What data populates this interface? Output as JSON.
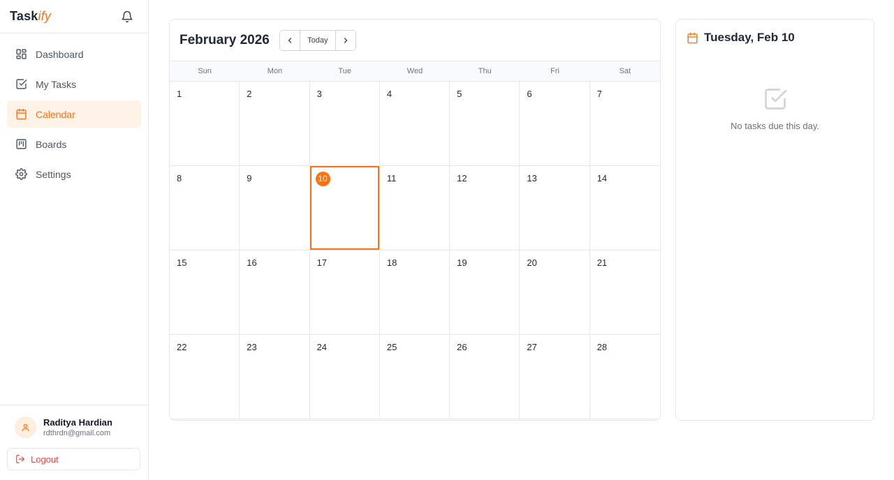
{
  "brand": {
    "name": "Task",
    "accent": "ify"
  },
  "nav": [
    {
      "label": "Dashboard",
      "icon": "dashboard-icon",
      "active": false
    },
    {
      "label": "My Tasks",
      "icon": "checkbox-icon",
      "active": false
    },
    {
      "label": "Calendar",
      "icon": "calendar-icon",
      "active": true
    },
    {
      "label": "Boards",
      "icon": "board-icon",
      "active": false
    },
    {
      "label": "Settings",
      "icon": "gear-icon",
      "active": false
    }
  ],
  "user": {
    "name": "Raditya Hardian",
    "email": "rdthrdn@gmail.com",
    "logout_label": "Logout"
  },
  "calendar": {
    "month_title": "February 2026",
    "today_label": "Today",
    "weekdays": [
      "Sun",
      "Mon",
      "Tue",
      "Wed",
      "Thu",
      "Fri",
      "Sat"
    ],
    "days": [
      "1",
      "2",
      "3",
      "4",
      "5",
      "6",
      "7",
      "8",
      "9",
      "10",
      "11",
      "12",
      "13",
      "14",
      "15",
      "16",
      "17",
      "18",
      "19",
      "20",
      "21",
      "22",
      "23",
      "24",
      "25",
      "26",
      "27",
      "28"
    ],
    "selected_day": "10"
  },
  "panel": {
    "title": "Tuesday, Feb 10",
    "empty_text": "No tasks due this day."
  },
  "colors": {
    "accent": "#f97316",
    "accent_bg": "#fff2e6",
    "danger": "#ef4444",
    "border": "#e5e7eb"
  }
}
